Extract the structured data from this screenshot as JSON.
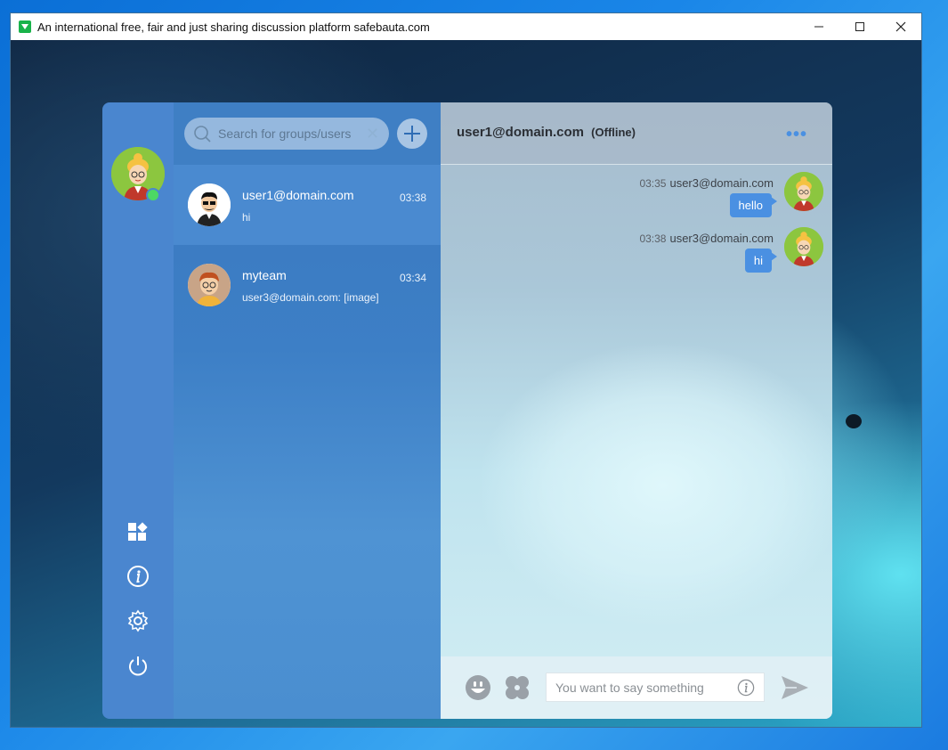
{
  "window": {
    "title": "An international free, fair and just sharing discussion platform safebauta.com",
    "minimize": "—",
    "maximize": "☐",
    "close": "✕"
  },
  "sidebar": {
    "user_status": "online",
    "icons": [
      "apps-icon",
      "info-icon",
      "settings-icon",
      "power-icon"
    ]
  },
  "search": {
    "placeholder": "Search for groups/users"
  },
  "conversations": [
    {
      "name": "user1@domain.com",
      "time": "03:38",
      "last_message": "hi",
      "active": true
    },
    {
      "name": "myteam",
      "time": "03:34",
      "last_message": "user3@domain.com: [image]",
      "active": false
    }
  ],
  "chat": {
    "title": "user1@domain.com",
    "status": "(Offline)",
    "more": "•••",
    "messages": [
      {
        "time": "03:35",
        "sender": "user3@domain.com",
        "text": "hello"
      },
      {
        "time": "03:38",
        "sender": "user3@domain.com",
        "text": "hi"
      }
    ]
  },
  "composer": {
    "placeholder": "You want to say something"
  },
  "colors": {
    "accent": "#4a90e2",
    "sidebar": "#4a86cf",
    "online": "#4cd964"
  }
}
